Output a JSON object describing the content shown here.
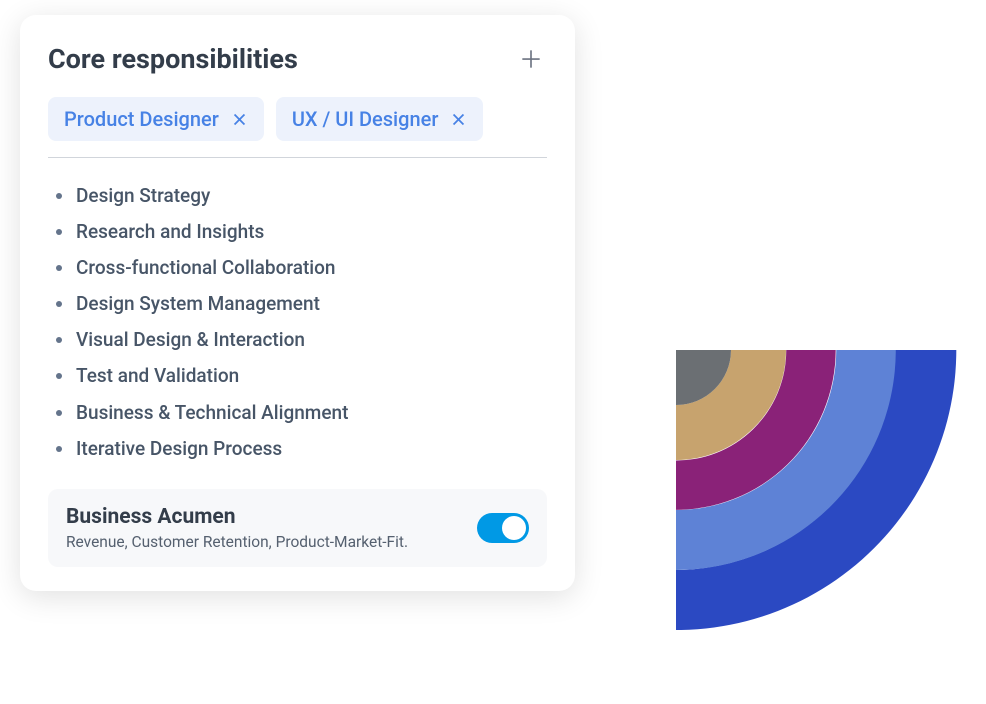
{
  "card": {
    "title": "Core responsibilities",
    "tags": [
      {
        "label": "Product Designer"
      },
      {
        "label": "UX / UI Designer"
      }
    ],
    "items": [
      "Design Strategy",
      "Research and Insights",
      "Cross-functional Collaboration",
      "Design System Management",
      "Visual Design & Interaction",
      "Test and Validation",
      "Business & Technical Alignment",
      "Iterative Design Process"
    ],
    "toggle": {
      "title": "Business Acumen",
      "subtitle": "Revenue, Customer Retention, Product-Market-Fit.",
      "on": true
    }
  },
  "chart": {
    "rings": [
      {
        "color": "#2b49c2",
        "radius": 280
      },
      {
        "color": "#5e82d6",
        "radius": 220
      },
      {
        "color": "#8a2278",
        "radius": 160
      },
      {
        "color": "#c7a36e",
        "radius": 110
      },
      {
        "color": "#6b6f73",
        "radius": 55
      }
    ]
  }
}
